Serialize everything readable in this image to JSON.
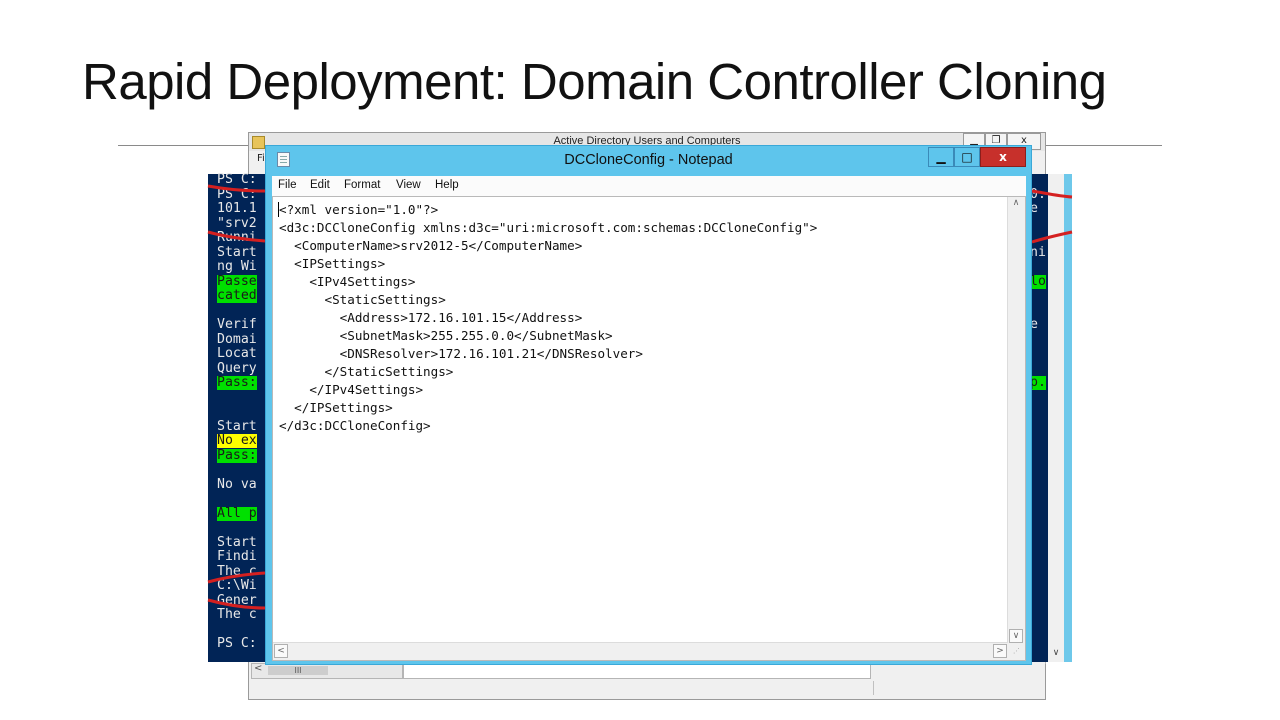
{
  "slide": {
    "title": "Rapid Deployment: Domain Controller Cloning"
  },
  "ad_window": {
    "title": "Active Directory Users and Computers",
    "menu_partial": "Fi",
    "min_glyph": "▁",
    "max_glyph": "❐",
    "close_glyph": "x",
    "scroll_left": "<",
    "scroll_thumb": "III",
    "scroll_down": "∨"
  },
  "powershell": {
    "left_lines": [
      {
        "text": "PS C:",
        "hl": ""
      },
      {
        "text": "PS C:",
        "hl": ""
      },
      {
        "text": "101.1",
        "hl": ""
      },
      {
        "text": "\"srv2",
        "hl": ""
      },
      {
        "text": "Runni",
        "hl": ""
      },
      {
        "text": "Start",
        "hl": ""
      },
      {
        "text": "ng Wi",
        "hl": ""
      },
      {
        "text": "Passe",
        "hl": "green"
      },
      {
        "text": "cated",
        "hl": "green"
      },
      {
        "text": "",
        "hl": ""
      },
      {
        "text": "Verif",
        "hl": ""
      },
      {
        "text": "Domai",
        "hl": ""
      },
      {
        "text": "Locat",
        "hl": ""
      },
      {
        "text": "Query",
        "hl": ""
      },
      {
        "text": "Pass:",
        "hl": "green"
      },
      {
        "text": "",
        "hl": ""
      },
      {
        "text": "",
        "hl": ""
      },
      {
        "text": "Start",
        "hl": ""
      },
      {
        "text": "No ex",
        "hl": "yellow"
      },
      {
        "text": "Pass:",
        "hl": "green"
      },
      {
        "text": "",
        "hl": ""
      },
      {
        "text": "No va",
        "hl": ""
      },
      {
        "text": "",
        "hl": ""
      },
      {
        "text": "All p",
        "hl": "green"
      },
      {
        "text": "",
        "hl": ""
      },
      {
        "text": "Start",
        "hl": ""
      },
      {
        "text": "Findi",
        "hl": ""
      },
      {
        "text": "The c",
        "hl": ""
      },
      {
        "text": "C:\\Wi",
        "hl": ""
      },
      {
        "text": "Gener",
        "hl": ""
      },
      {
        "text": "The c",
        "hl": ""
      },
      {
        "text": "",
        "hl": ""
      },
      {
        "text": "PS C:",
        "hl": ""
      }
    ],
    "right_lines": [
      {
        "text": "",
        "hl": ""
      },
      {
        "text": "0.",
        "hl": ""
      },
      {
        "text": "e",
        "hl": ""
      },
      {
        "text": "",
        "hl": ""
      },
      {
        "text": "",
        "hl": ""
      },
      {
        "text": "ni",
        "hl": ""
      },
      {
        "text": "",
        "hl": ""
      },
      {
        "text": "lo",
        "hl": "green"
      },
      {
        "text": "",
        "hl": ""
      },
      {
        "text": "",
        "hl": ""
      },
      {
        "text": "e",
        "hl": ""
      },
      {
        "text": "",
        "hl": ""
      },
      {
        "text": "",
        "hl": ""
      },
      {
        "text": "",
        "hl": ""
      },
      {
        "text": "p.",
        "hl": "green"
      }
    ]
  },
  "notepad": {
    "title": "DCCloneConfig - Notepad",
    "min_glyph": "▁",
    "max_glyph": "□",
    "close_glyph": "x",
    "menu": [
      "File",
      "Edit",
      "Format",
      "View",
      "Help"
    ],
    "lines": [
      "<?xml version=\"1.0\"?>",
      "<d3c:DCCloneConfig xmlns:d3c=\"uri:microsoft.com:schemas:DCCloneConfig\">",
      "  <ComputerName>srv2012-5</ComputerName>",
      "  <IPSettings>",
      "    <IPv4Settings>",
      "      <StaticSettings>",
      "        <Address>172.16.101.15</Address>",
      "        <SubnetMask>255.255.0.0</SubnetMask>",
      "        <DNSResolver>172.16.101.21</DNSResolver>",
      "      </StaticSettings>",
      "    </IPv4Settings>",
      "  </IPSettings>",
      "</d3c:DCCloneConfig>"
    ],
    "scroll_up": "∧",
    "scroll_down": "∨",
    "scroll_left": "<",
    "scroll_right": ">",
    "grip": "⋰"
  },
  "colors": {
    "ps_background": "#012456",
    "notepad_frame": "#5ec5ec",
    "close_button": "#c7302b",
    "red_annotation": "#d42020",
    "highlight_green": "#00e000",
    "highlight_yellow": "#ffff00"
  }
}
